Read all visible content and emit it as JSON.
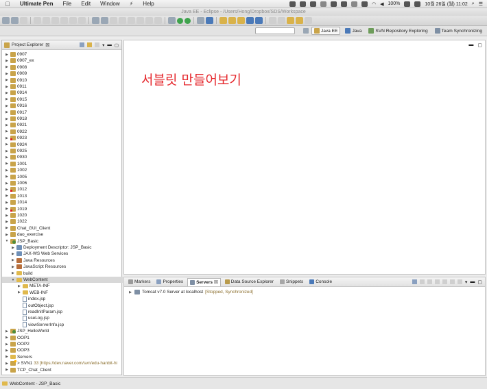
{
  "menubar": {
    "app": "Ultimate Pen",
    "items": [
      "File",
      "Edit",
      "Window",
      "Help"
    ],
    "battery": "100%",
    "datetime": "10월 26일 (월)  11:02"
  },
  "window": {
    "title": "Java EE - Eclipse - /Users/Hong/Dropbox/SDS/Workspace"
  },
  "perspectives": [
    {
      "label": "Java EE",
      "active": true
    },
    {
      "label": "Java"
    },
    {
      "label": "SVN Repository Exploring"
    },
    {
      "label": "Team Synchronizing"
    }
  ],
  "explorer": {
    "tab_label": "Project Explorer",
    "close": "☒",
    "rows": [
      {
        "label": "0907",
        "indent": 0,
        "arrow": "▶",
        "icon": "project"
      },
      {
        "label": "0907_ex",
        "indent": 0,
        "arrow": "▶",
        "icon": "project"
      },
      {
        "label": "0908",
        "indent": 0,
        "arrow": "▶",
        "icon": "project"
      },
      {
        "label": "0909",
        "indent": 0,
        "arrow": "▶",
        "icon": "project"
      },
      {
        "label": "0910",
        "indent": 0,
        "arrow": "▶",
        "icon": "project"
      },
      {
        "label": "0911",
        "indent": 0,
        "arrow": "▶",
        "icon": "project"
      },
      {
        "label": "0914",
        "indent": 0,
        "arrow": "▶",
        "icon": "project"
      },
      {
        "label": "0915",
        "indent": 0,
        "arrow": "▶",
        "icon": "project"
      },
      {
        "label": "0916",
        "indent": 0,
        "arrow": "▶",
        "icon": "project"
      },
      {
        "label": "0917",
        "indent": 0,
        "arrow": "▶",
        "icon": "project"
      },
      {
        "label": "0918",
        "indent": 0,
        "arrow": "▶",
        "icon": "project"
      },
      {
        "label": "0921",
        "indent": 0,
        "arrow": "▶",
        "icon": "project"
      },
      {
        "label": "0922",
        "indent": 0,
        "arrow": "▶",
        "icon": "project"
      },
      {
        "label": "0923",
        "indent": 0,
        "arrow": "▶",
        "icon": "project-error"
      },
      {
        "label": "0924",
        "indent": 0,
        "arrow": "▶",
        "icon": "project"
      },
      {
        "label": "0925",
        "indent": 0,
        "arrow": "▶",
        "icon": "project"
      },
      {
        "label": "0930",
        "indent": 0,
        "arrow": "▶",
        "icon": "project"
      },
      {
        "label": "1001",
        "indent": 0,
        "arrow": "▶",
        "icon": "project"
      },
      {
        "label": "1002",
        "indent": 0,
        "arrow": "▶",
        "icon": "project"
      },
      {
        "label": "1005",
        "indent": 0,
        "arrow": "▶",
        "icon": "project"
      },
      {
        "label": "1006",
        "indent": 0,
        "arrow": "▶",
        "icon": "project"
      },
      {
        "label": "1012",
        "indent": 0,
        "arrow": "▶",
        "icon": "project-error"
      },
      {
        "label": "1013",
        "indent": 0,
        "arrow": "▶",
        "icon": "project"
      },
      {
        "label": "1014",
        "indent": 0,
        "arrow": "▶",
        "icon": "project"
      },
      {
        "label": "1019",
        "indent": 0,
        "arrow": "▶",
        "icon": "project-error"
      },
      {
        "label": "1020",
        "indent": 0,
        "arrow": "▶",
        "icon": "project"
      },
      {
        "label": "1022",
        "indent": 0,
        "arrow": "▶",
        "icon": "project"
      },
      {
        "label": "Chat_GUI_Client",
        "indent": 0,
        "arrow": "▶",
        "icon": "project"
      },
      {
        "label": "dao_exercise",
        "indent": 0,
        "arrow": "▶",
        "icon": "project"
      },
      {
        "label": "JSP_Basic",
        "indent": 0,
        "arrow": "▼",
        "icon": "project-web"
      },
      {
        "label": "Deployment Descriptor: JSP_Basic",
        "indent": 1,
        "arrow": "▶",
        "icon": "descriptor"
      },
      {
        "label": "JAX-WS Web Services",
        "indent": 1,
        "arrow": "▶",
        "icon": "descriptor"
      },
      {
        "label": "Java Resources",
        "indent": 1,
        "arrow": "▶",
        "icon": "jar"
      },
      {
        "label": "JavaScript Resources",
        "indent": 1,
        "arrow": "▶",
        "icon": "jar"
      },
      {
        "label": "build",
        "indent": 1,
        "arrow": "▶",
        "icon": "folder"
      },
      {
        "label": "WebContent",
        "indent": 1,
        "arrow": "▼",
        "icon": "folder",
        "selected": true
      },
      {
        "label": "META-INF",
        "indent": 2,
        "arrow": "▶",
        "icon": "folder"
      },
      {
        "label": "WEB-INF",
        "indent": 2,
        "arrow": "▶",
        "icon": "folder"
      },
      {
        "label": "index.jsp",
        "indent": 2,
        "arrow": "",
        "icon": "file"
      },
      {
        "label": "outObject.jsp",
        "indent": 2,
        "arrow": "",
        "icon": "file"
      },
      {
        "label": "readInitParam.jsp",
        "indent": 2,
        "arrow": "",
        "icon": "file"
      },
      {
        "label": "useLog.jsp",
        "indent": 2,
        "arrow": "",
        "icon": "file"
      },
      {
        "label": "viewServerInfo.jsp",
        "indent": 2,
        "arrow": "",
        "icon": "file"
      },
      {
        "label": "JSP_HelloWorld",
        "indent": 0,
        "arrow": "▶",
        "icon": "project-web"
      },
      {
        "label": "OOP1",
        "indent": 0,
        "arrow": "▶",
        "icon": "project"
      },
      {
        "label": "OOP2",
        "indent": 0,
        "arrow": "▶",
        "icon": "project"
      },
      {
        "label": "OOP3",
        "indent": 0,
        "arrow": "▶",
        "icon": "project"
      },
      {
        "label": "Servers",
        "indent": 0,
        "arrow": "▶",
        "icon": "folder"
      },
      {
        "label": "> SVN1",
        "note": "33 [https://dev.naver.com/svn/edu-hanbit-hi",
        "indent": 0,
        "arrow": "▶",
        "icon": "project-svn"
      },
      {
        "label": "TCP_Chat_Client",
        "indent": 0,
        "arrow": "▶",
        "icon": "project"
      }
    ]
  },
  "editor": {
    "text": "서블릿 만들어보기"
  },
  "servers_panel": {
    "tabs": [
      {
        "label": "Markers",
        "icon_color": "#9a9a9a"
      },
      {
        "label": "Properties",
        "icon_color": "#8aa0c0"
      },
      {
        "label": "Servers",
        "active": true,
        "close": "☒",
        "icon_color": "#7e8fa4"
      },
      {
        "label": "Data Source Explorer",
        "icon_color": "#b89a4a"
      },
      {
        "label": "Snippets",
        "icon_color": "#a7a7a7"
      },
      {
        "label": "Console",
        "icon_color": "#4a79b8"
      }
    ],
    "server": {
      "name": "Tomcat v7.0 Server at localhost",
      "state": "[Stopped, Synchronized]"
    }
  },
  "statusbar": {
    "text": "WebContent - JSP_Basic"
  }
}
